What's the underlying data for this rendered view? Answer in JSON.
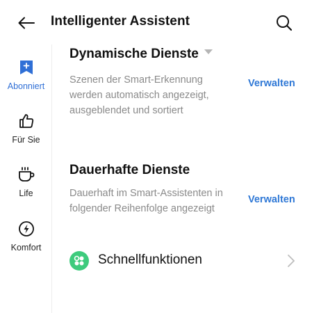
{
  "header": {
    "title": "Intelligenter Assistent",
    "back_icon": "arrow-left-icon",
    "search_icon": "search-icon"
  },
  "sidebar": {
    "items": [
      {
        "label": "Abonniert",
        "icon": "bookmark-plus-icon",
        "active": true
      },
      {
        "label": "Für Sie",
        "icon": "thumbs-up-icon",
        "active": false
      },
      {
        "label": "Life",
        "icon": "coffee-cup-icon",
        "active": false
      },
      {
        "label": "Komfort",
        "icon": "lightning-icon",
        "active": false
      }
    ]
  },
  "sections": {
    "dynamic": {
      "title": "Dynamische Dienste",
      "description": "Szenen der Smart-Erkennung werden automatisch angezeigt, ausgeblendet und sortiert",
      "manage_label": "Verwalten"
    },
    "permanent": {
      "title": "Dauerhafte Dienste",
      "description": "Dauerhaft im Smart-Assistenten in folgender Reihenfolge angezeigt",
      "manage_label": "Verwalten"
    }
  },
  "shortcut": {
    "label": "Schnellfunktionen",
    "icon": "four-dots-icon"
  },
  "colors": {
    "accent": "#2f78d6",
    "active_nav": "#2f6fd6",
    "shortcut_green": "#3ecb7d",
    "muted_text": "#8a8a8a"
  }
}
